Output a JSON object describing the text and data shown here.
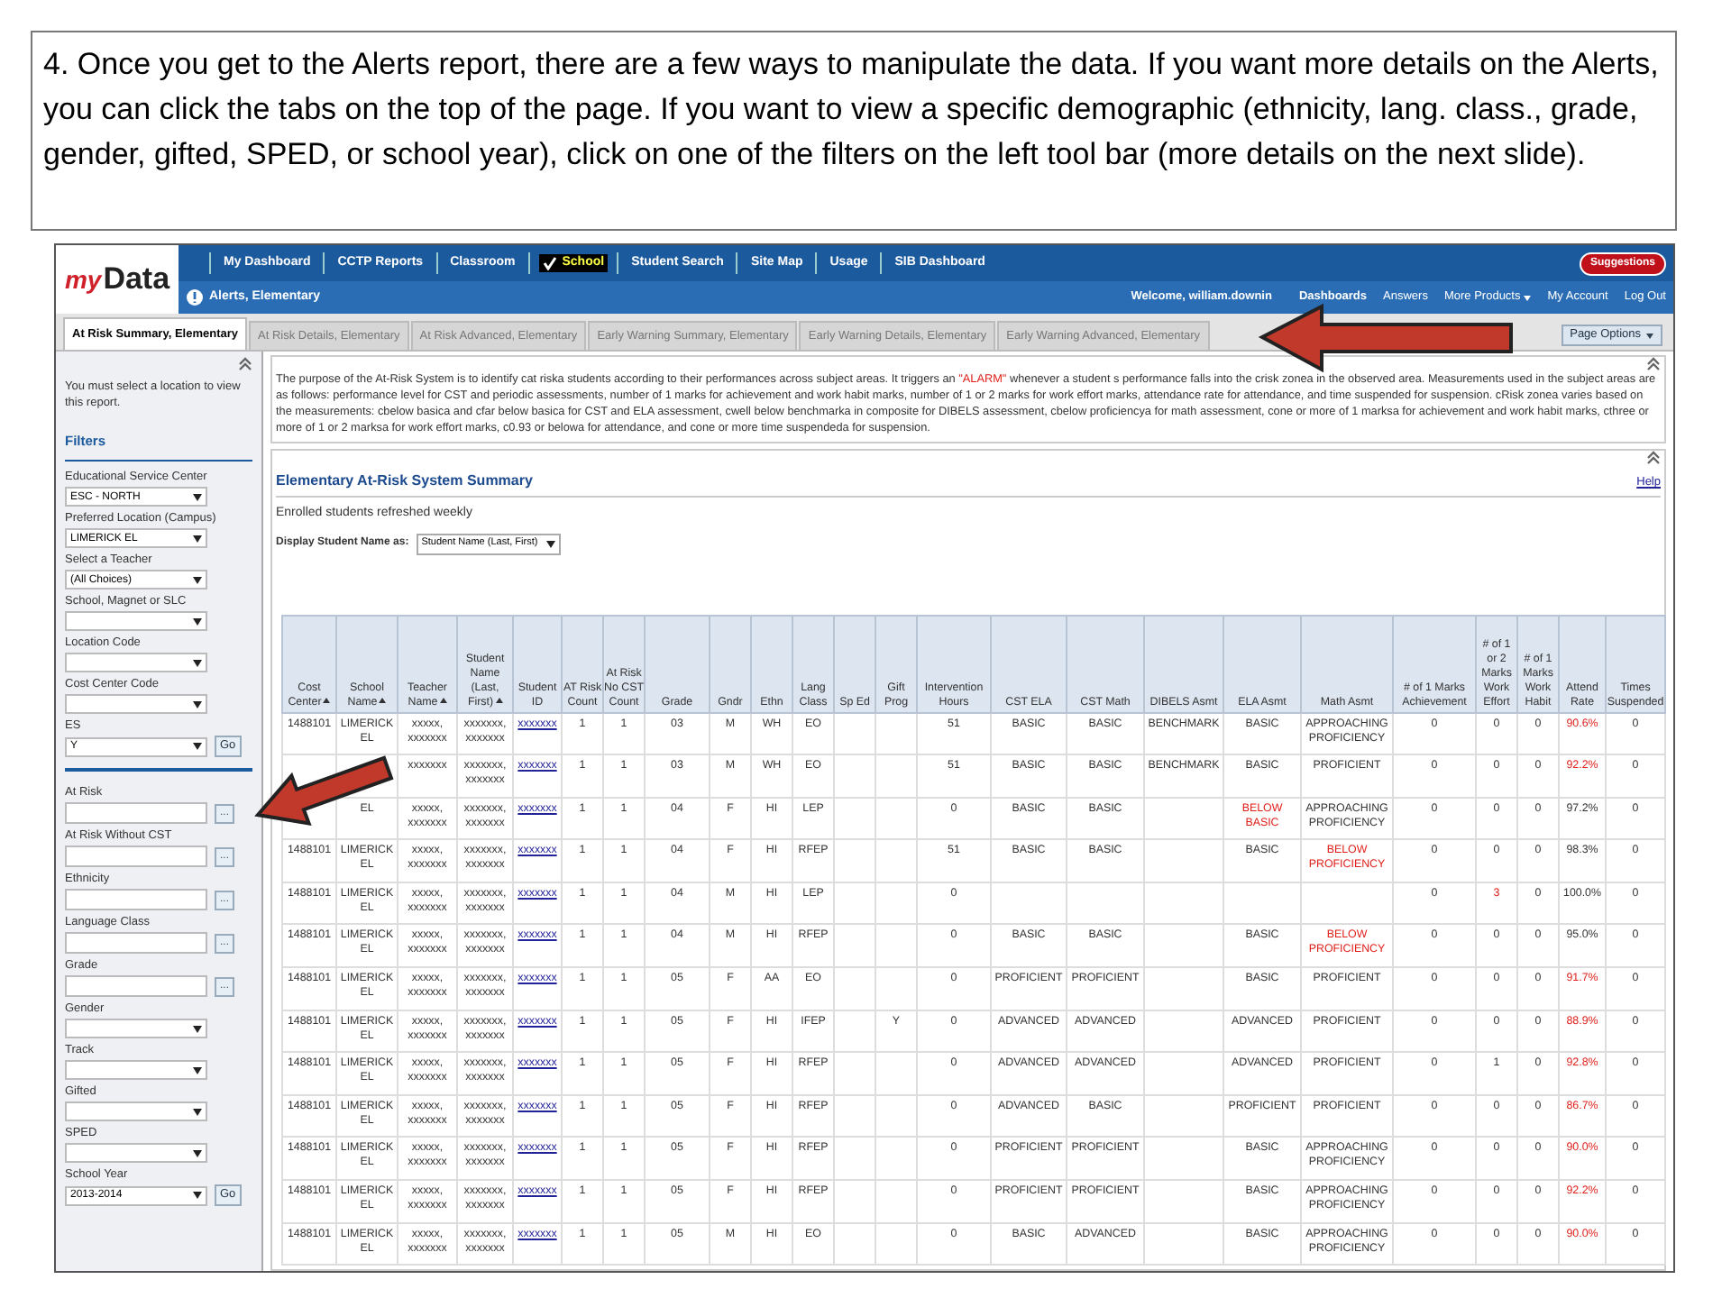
{
  "slide_text": "4. Once you get to the Alerts report, there are a few ways to manipulate the data.  If you want more details on the Alerts, you can click the tabs on the top of the page.  If you want to view a specific demographic (ethnicity, lang. class., grade, gender, gifted, SPED, or school year), click on one of the filters on the left tool bar (more details on the next slide).",
  "logo": {
    "prefix": "my",
    "main": "Data"
  },
  "nav": [
    {
      "label": "My Dashboard",
      "selected": false
    },
    {
      "label": "CCTP Reports",
      "selected": false
    },
    {
      "label": "Classroom",
      "selected": false
    },
    {
      "label": "School",
      "selected": true
    },
    {
      "label": "Student Search",
      "selected": false
    },
    {
      "label": "Site Map",
      "selected": false
    },
    {
      "label": "Usage",
      "selected": false
    },
    {
      "label": "SIB Dashboard",
      "selected": false
    }
  ],
  "suggestions_button": "Suggestions",
  "page_title": "Alerts, Elementary",
  "welcome": "Welcome, william.downin",
  "user_links": [
    {
      "label": "Dashboards",
      "bold": true,
      "menu": false
    },
    {
      "label": "Answers",
      "bold": false,
      "menu": false
    },
    {
      "label": "More Products",
      "bold": false,
      "menu": true
    },
    {
      "label": "My Account",
      "bold": false,
      "menu": false
    },
    {
      "label": "Log Out",
      "bold": false,
      "menu": false
    }
  ],
  "tabs": [
    {
      "label": "At Risk Summary, Elementary",
      "selected": true
    },
    {
      "label": "At Risk Details, Elementary",
      "selected": false
    },
    {
      "label": "At Risk Advanced, Elementary",
      "selected": false
    },
    {
      "label": "Early Warning Summary, Elementary",
      "selected": false
    },
    {
      "label": "Early Warning Details, Elementary",
      "selected": false
    },
    {
      "label": "Early Warning Advanced, Elementary",
      "selected": false
    }
  ],
  "page_options": "Page Options",
  "sidebar": {
    "note": "You must select a location to view this report.",
    "heading": "Filters",
    "groups": [
      [
        {
          "kind": "select",
          "label": "Educational Service Center",
          "value": "ESC - NORTH"
        },
        {
          "kind": "select",
          "label": "Preferred Location (Campus)",
          "value": "LIMERICK EL"
        },
        {
          "kind": "select",
          "label": "Select a Teacher",
          "value": "(All Choices)"
        },
        {
          "kind": "select",
          "label": "School, Magnet or SLC"
        },
        {
          "kind": "select",
          "label": "Location Code"
        },
        {
          "kind": "select",
          "label": "Cost Center Code"
        },
        {
          "kind": "select",
          "label": "ES",
          "value": "Y",
          "go": "Go"
        }
      ],
      [
        {
          "kind": "picker",
          "label": "At Risk",
          "button": "..."
        },
        {
          "kind": "picker",
          "label": "At Risk Without CST",
          "button": "..."
        },
        {
          "kind": "picker",
          "label": "Ethnicity",
          "button": "..."
        },
        {
          "kind": "picker",
          "label": "Language Class",
          "button": "..."
        },
        {
          "kind": "picker",
          "label": "Grade",
          "button": "..."
        },
        {
          "kind": "select",
          "label": "Gender"
        },
        {
          "kind": "select",
          "label": "Track"
        },
        {
          "kind": "select",
          "label": "Gifted"
        },
        {
          "kind": "select",
          "label": "SPED"
        },
        {
          "kind": "select",
          "label": "School Year",
          "value": "2013-2014",
          "go": "Go"
        }
      ]
    ]
  },
  "description": [
    {
      "text": "The purpose of the At-Risk System is to identify cat riska students according to their performances across subject areas. It triggers an ",
      "highlight": false
    },
    {
      "text": "\"ALARM\"",
      "highlight": true
    },
    {
      "text": " whenever a student s performance falls into the crisk zonea in the observed area. Measurements used in the subject areas are as follows: performance level for CST and periodic assessments, number of 1 marks for achievement and work habit marks, number of 1 or 2 marks for work effort marks, attendance rate for attendance, and time suspended for suspension. cRisk zonea varies based on the measurements: cbelow basica and cfar below basica for CST and ELA assessment, cwell below benchmarka in composite for DIBELS assessment, cbelow proficiencya for math assessment, cone or more of 1 marksa for achievement and work habit marks, cthree or more of 1 or 2 marksa for work effort marks, c0.93 or belowa for attendance, and cone or more time suspendeda for suspension.",
      "highlight": false
    }
  ],
  "report": {
    "title": "Elementary At-Risk System Summary",
    "help": "Help",
    "subtitle": "Enrolled students refreshed weekly",
    "display_label": "Display Student Name as:",
    "display_value": "Student Name (Last, First)",
    "columns": [
      {
        "label": "Cost Center",
        "sortable": true,
        "kind": "text"
      },
      {
        "label": "School Name",
        "sortable": true,
        "kind": "text"
      },
      {
        "label": "Teacher Name",
        "sortable": true,
        "kind": "text"
      },
      {
        "label": "Student Name (Last, First)",
        "sortable": true,
        "kind": "text"
      },
      {
        "label": "Student ID",
        "sortable": false,
        "kind": "link"
      },
      {
        "label": "AT Risk Count",
        "sortable": false,
        "kind": "text"
      },
      {
        "label": "At Risk No CST Count",
        "sortable": false,
        "kind": "text"
      },
      {
        "label": "Grade",
        "sortable": false,
        "kind": "text"
      },
      {
        "label": "Gndr",
        "sortable": false,
        "kind": "text"
      },
      {
        "label": "Ethn",
        "sortable": false,
        "kind": "text"
      },
      {
        "label": "Lang Class",
        "sortable": false,
        "kind": "text"
      },
      {
        "label": "Sp Ed",
        "sortable": false,
        "kind": "text"
      },
      {
        "label": "Gift Prog",
        "sortable": false,
        "kind": "text"
      },
      {
        "label": "Intervention Hours",
        "sortable": false,
        "kind": "text"
      },
      {
        "label": "CST ELA",
        "sortable": false,
        "kind": "text"
      },
      {
        "label": "CST Math",
        "sortable": false,
        "kind": "text"
      },
      {
        "label": "DIBELS Asmt",
        "sortable": false,
        "kind": "text"
      },
      {
        "label": "ELA Asmt",
        "sortable": false,
        "kind": "text"
      },
      {
        "label": "Math Asmt",
        "sortable": false,
        "kind": "text"
      },
      {
        "label": "# of 1 Marks Achievement",
        "sortable": false,
        "kind": "text"
      },
      {
        "label": "# of 1 or 2 Marks Work Effort",
        "sortable": false,
        "kind": "text"
      },
      {
        "label": "# of 1 Marks Work Habit",
        "sortable": false,
        "kind": "text"
      },
      {
        "label": "Attend Rate",
        "sortable": false,
        "kind": "text"
      },
      {
        "label": "Times Suspended",
        "sortable": false,
        "kind": "text"
      }
    ],
    "rows": [
      {
        "cells": [
          "1488101",
          "LIMERICK EL",
          "xxxxx, xxxxxxx",
          "xxxxxxx, xxxxxxx",
          "xxxxxxx",
          "1",
          "1",
          "03",
          "M",
          "WH",
          "EO",
          null,
          null,
          "51",
          "BASIC",
          "BASIC",
          "BENCHMARK",
          {
            "text": "BASIC",
            "alert": false
          },
          {
            "text": "APPROACHING PROFICIENCY",
            "alert": false
          },
          "0",
          {
            "text": "0",
            "alert": false
          },
          "0",
          {
            "text": "90.6%",
            "alert": true
          },
          "0"
        ]
      },
      {
        "cells": [
          null,
          null,
          "xxxxxxx",
          "xxxxxxx, xxxxxxx",
          "xxxxxxx",
          "1",
          "1",
          "03",
          "M",
          "WH",
          "EO",
          null,
          null,
          "51",
          "BASIC",
          "BASIC",
          "BENCHMARK",
          {
            "text": "BASIC",
            "alert": false
          },
          {
            "text": "PROFICIENT",
            "alert": false
          },
          "0",
          {
            "text": "0",
            "alert": false
          },
          "0",
          {
            "text": "92.2%",
            "alert": true
          },
          "0"
        ]
      },
      {
        "cells": [
          null,
          "EL",
          "xxxxx, xxxxxxx",
          "xxxxxxx, xxxxxxx",
          "xxxxxxx",
          "1",
          "1",
          "04",
          "F",
          "HI",
          "LEP",
          null,
          null,
          "0",
          "BASIC",
          "BASIC",
          null,
          {
            "text": "BELOW BASIC",
            "alert": true
          },
          {
            "text": "APPROACHING PROFICIENCY",
            "alert": false
          },
          "0",
          {
            "text": "0",
            "alert": false
          },
          "0",
          {
            "text": "97.2%",
            "alert": false
          },
          "0"
        ]
      },
      {
        "cells": [
          "1488101",
          "LIMERICK EL",
          "xxxxx, xxxxxxx",
          "xxxxxxx, xxxxxxx",
          "xxxxxxx",
          "1",
          "1",
          "04",
          "F",
          "HI",
          "RFEP",
          null,
          null,
          "51",
          "BASIC",
          "BASIC",
          null,
          {
            "text": "BASIC",
            "alert": false
          },
          {
            "text": "BELOW PROFICIENCY",
            "alert": true
          },
          "0",
          {
            "text": "0",
            "alert": false
          },
          "0",
          {
            "text": "98.3%",
            "alert": false
          },
          "0"
        ]
      },
      {
        "cells": [
          "1488101",
          "LIMERICK EL",
          "xxxxx, xxxxxxx",
          "xxxxxxx, xxxxxxx",
          "xxxxxxx",
          "1",
          "1",
          "04",
          "M",
          "HI",
          "LEP",
          null,
          null,
          "0",
          null,
          null,
          null,
          null,
          null,
          "0",
          {
            "text": "3",
            "alert": true
          },
          "0",
          {
            "text": "100.0%",
            "alert": false
          },
          "0"
        ]
      },
      {
        "cells": [
          "1488101",
          "LIMERICK EL",
          "xxxxx, xxxxxxx",
          "xxxxxxx, xxxxxxx",
          "xxxxxxx",
          "1",
          "1",
          "04",
          "M",
          "HI",
          "RFEP",
          null,
          null,
          "0",
          "BASIC",
          "BASIC",
          null,
          {
            "text": "BASIC",
            "alert": false
          },
          {
            "text": "BELOW PROFICIENCY",
            "alert": true
          },
          "0",
          {
            "text": "0",
            "alert": false
          },
          "0",
          {
            "text": "95.0%",
            "alert": false
          },
          "0"
        ]
      },
      {
        "cells": [
          "1488101",
          "LIMERICK EL",
          "xxxxx, xxxxxxx",
          "xxxxxxx, xxxxxxx",
          "xxxxxxx",
          "1",
          "1",
          "05",
          "F",
          "AA",
          "EO",
          null,
          null,
          "0",
          "PROFICIENT",
          "PROFICIENT",
          null,
          {
            "text": "BASIC",
            "alert": false
          },
          {
            "text": "PROFICIENT",
            "alert": false
          },
          "0",
          {
            "text": "0",
            "alert": false
          },
          "0",
          {
            "text": "91.7%",
            "alert": true
          },
          "0"
        ]
      },
      {
        "cells": [
          "1488101",
          "LIMERICK EL",
          "xxxxx, xxxxxxx",
          "xxxxxxx, xxxxxxx",
          "xxxxxxx",
          "1",
          "1",
          "05",
          "F",
          "HI",
          "IFEP",
          null,
          "Y",
          "0",
          "ADVANCED",
          "ADVANCED",
          null,
          {
            "text": "ADVANCED",
            "alert": false
          },
          {
            "text": "PROFICIENT",
            "alert": false
          },
          "0",
          {
            "text": "0",
            "alert": false
          },
          "0",
          {
            "text": "88.9%",
            "alert": true
          },
          "0"
        ]
      },
      {
        "cells": [
          "1488101",
          "LIMERICK EL",
          "xxxxx, xxxxxxx",
          "xxxxxxx, xxxxxxx",
          "xxxxxxx",
          "1",
          "1",
          "05",
          "F",
          "HI",
          "RFEP",
          null,
          null,
          "0",
          "ADVANCED",
          "ADVANCED",
          null,
          {
            "text": "ADVANCED",
            "alert": false
          },
          {
            "text": "PROFICIENT",
            "alert": false
          },
          "0",
          {
            "text": "1",
            "alert": false
          },
          "0",
          {
            "text": "92.8%",
            "alert": true
          },
          "0"
        ]
      },
      {
        "cells": [
          "1488101",
          "LIMERICK EL",
          "xxxxx, xxxxxxx",
          "xxxxxxx, xxxxxxx",
          "xxxxxxx",
          "1",
          "1",
          "05",
          "F",
          "HI",
          "RFEP",
          null,
          null,
          "0",
          "ADVANCED",
          "BASIC",
          null,
          {
            "text": "PROFICIENT",
            "alert": false
          },
          {
            "text": "PROFICIENT",
            "alert": false
          },
          "0",
          {
            "text": "0",
            "alert": false
          },
          "0",
          {
            "text": "86.7%",
            "alert": true
          },
          "0"
        ]
      },
      {
        "cells": [
          "1488101",
          "LIMERICK EL",
          "xxxxx, xxxxxxx",
          "xxxxxxx, xxxxxxx",
          "xxxxxxx",
          "1",
          "1",
          "05",
          "F",
          "HI",
          "RFEP",
          null,
          null,
          "0",
          "PROFICIENT",
          "PROFICIENT",
          null,
          {
            "text": "BASIC",
            "alert": false
          },
          {
            "text": "APPROACHING PROFICIENCY",
            "alert": false
          },
          "0",
          {
            "text": "0",
            "alert": false
          },
          "0",
          {
            "text": "90.0%",
            "alert": true
          },
          "0"
        ]
      },
      {
        "cells": [
          "1488101",
          "LIMERICK EL",
          "xxxxx, xxxxxxx",
          "xxxxxxx, xxxxxxx",
          "xxxxxxx",
          "1",
          "1",
          "05",
          "F",
          "HI",
          "RFEP",
          null,
          null,
          "0",
          "PROFICIENT",
          "PROFICIENT",
          null,
          {
            "text": "BASIC",
            "alert": false
          },
          {
            "text": "APPROACHING PROFICIENCY",
            "alert": false
          },
          "0",
          {
            "text": "0",
            "alert": false
          },
          "0",
          {
            "text": "92.2%",
            "alert": true
          },
          "0"
        ]
      },
      {
        "cells": [
          "1488101",
          "LIMERICK EL",
          "xxxxx, xxxxxxx",
          "xxxxxxx, xxxxxxx",
          "xxxxxxx",
          "1",
          "1",
          "05",
          "M",
          "HI",
          "EO",
          null,
          null,
          "0",
          "BASIC",
          "ADVANCED",
          null,
          {
            "text": "BASIC",
            "alert": false
          },
          {
            "text": "APPROACHING PROFICIENCY",
            "alert": false
          },
          "0",
          {
            "text": "0",
            "alert": false
          },
          "0",
          {
            "text": "90.0%",
            "alert": true
          },
          "0"
        ]
      }
    ]
  }
}
